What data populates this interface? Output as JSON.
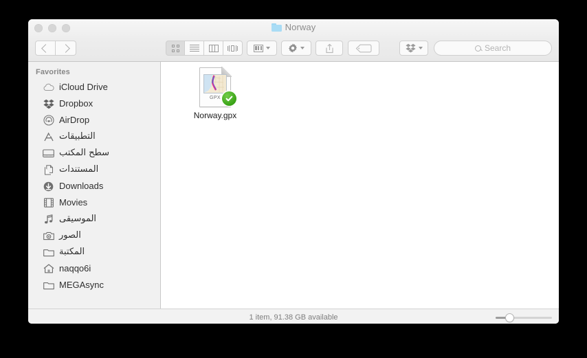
{
  "window": {
    "title": "Norway",
    "title_icon": "folder-icon",
    "traffic_lights": [
      "close-button",
      "minimize-button",
      "maximize-button"
    ],
    "folder_color": "#a9dcf5"
  },
  "toolbar": {
    "back_label": "Back",
    "forward_label": "Forward",
    "view_buttons": [
      {
        "name": "icon-view",
        "icon": "grid-icon",
        "active": true
      },
      {
        "name": "list-view",
        "icon": "list-icon",
        "active": false
      },
      {
        "name": "column-view",
        "icon": "columns-icon",
        "active": false
      },
      {
        "name": "coverflow-view",
        "icon": "coverflow-icon",
        "active": false
      }
    ],
    "arrange_label": "Arrange",
    "action_label": "Action",
    "share_label": "Share",
    "tag_label": "Tags",
    "dropbox_label": "Dropbox"
  },
  "search": {
    "placeholder": "Search",
    "value": ""
  },
  "sidebar": {
    "header": "Favorites",
    "items": [
      {
        "label": "iCloud Drive",
        "icon": "cloud-icon",
        "rtl": false
      },
      {
        "label": "Dropbox",
        "icon": "dropbox-icon",
        "rtl": false
      },
      {
        "label": "AirDrop",
        "icon": "airdrop-icon",
        "rtl": false
      },
      {
        "label": "التطبيقات",
        "icon": "applications-icon",
        "rtl": true
      },
      {
        "label": "سطح المكتب",
        "icon": "desktop-icon",
        "rtl": true
      },
      {
        "label": "المستندات",
        "icon": "documents-icon",
        "rtl": true
      },
      {
        "label": "Downloads",
        "icon": "downloads-icon",
        "rtl": false
      },
      {
        "label": "Movies",
        "icon": "movies-icon",
        "rtl": false
      },
      {
        "label": "الموسيقى",
        "icon": "music-icon",
        "rtl": true
      },
      {
        "label": "الصور",
        "icon": "pictures-icon",
        "rtl": true
      },
      {
        "label": "المكتبة",
        "icon": "folder-icon",
        "rtl": true
      },
      {
        "label": "naqqo6i",
        "icon": "home-icon",
        "rtl": false
      },
      {
        "label": "MEGAsync",
        "icon": "folder-icon",
        "rtl": false
      }
    ]
  },
  "content": {
    "files": [
      {
        "name": "Norway.gpx",
        "type_label": "GPX",
        "icon": "gpx-document-icon",
        "badge": "dropbox-synced-check",
        "badge_color": "#3aa316"
      }
    ]
  },
  "statusbar": {
    "text": "1 item, 91.38 GB available",
    "zoom_percent": 25
  }
}
